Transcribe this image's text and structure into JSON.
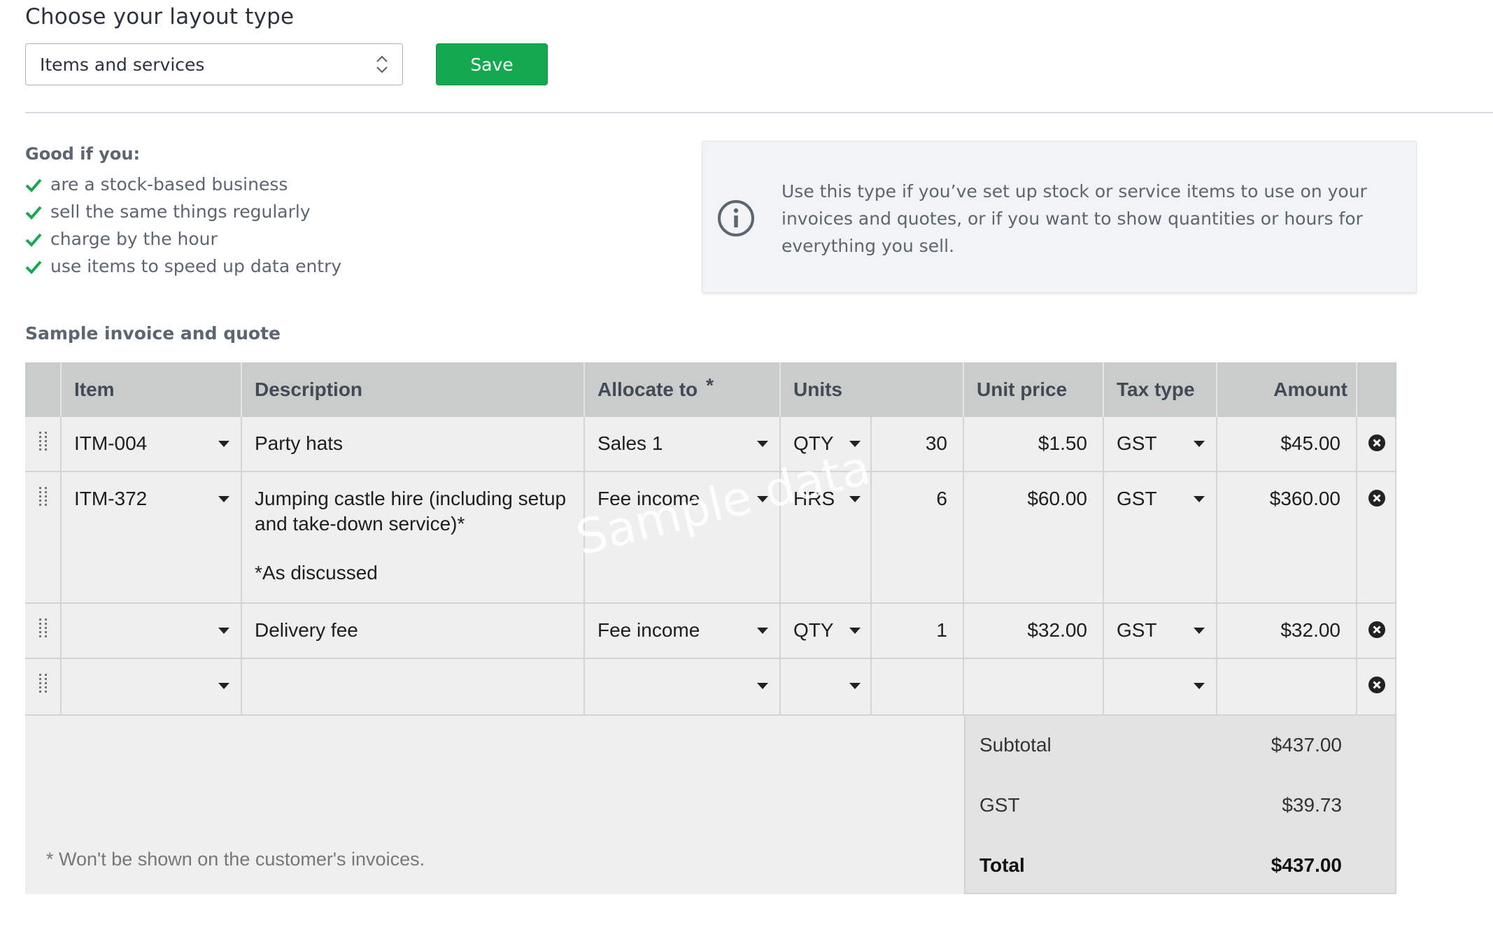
{
  "layout": {
    "title": "Choose your layout type",
    "selected": "Items and services",
    "save_label": "Save"
  },
  "good_if": {
    "heading": "Good if you:",
    "items": [
      "are a stock-based business",
      "sell the same things regularly",
      "charge by the hour",
      "use items to speed up data entry"
    ]
  },
  "info": {
    "text": "Use this type if you’ve set up stock or service items to use on your invoices and quotes, or if you want to show quantities or hours for everything you sell."
  },
  "sample": {
    "heading": "Sample invoice and quote",
    "watermark": "Sample data",
    "columns": {
      "item": "Item",
      "description": "Description",
      "allocate": "Allocate to",
      "allocate_mark": "*",
      "units": "Units",
      "unit_price": "Unit price",
      "tax_type": "Tax type",
      "amount": "Amount"
    },
    "rows": [
      {
        "item": "ITM-004",
        "description": [
          "Party hats"
        ],
        "allocate": "Sales 1",
        "unit": "QTY",
        "qty": "30",
        "unit_price": "$1.50",
        "tax": "GST",
        "amount": "$45.00"
      },
      {
        "item": "ITM-372",
        "description": [
          "Jumping castle hire (including setup",
          "and take-down service)*",
          "*As discussed"
        ],
        "allocate": "Fee income",
        "unit": "HRS",
        "qty": "6",
        "unit_price": "$60.00",
        "tax": "GST",
        "amount": "$360.00"
      },
      {
        "item": "",
        "description": [
          "Delivery fee"
        ],
        "allocate": "Fee income",
        "unit": "QTY",
        "qty": "1",
        "unit_price": "$32.00",
        "tax": "GST",
        "amount": "$32.00"
      },
      {
        "item": "",
        "description": [
          ""
        ],
        "allocate": "",
        "unit": "",
        "qty": "",
        "unit_price": "",
        "tax": "",
        "amount": ""
      }
    ],
    "totals": {
      "subtotal_label": "Subtotal",
      "subtotal": "$437.00",
      "tax_label": "GST",
      "tax": "$39.73",
      "total_label": "Total",
      "total": "$437.00"
    },
    "footnote": "* Won't be shown on the customer's invoices."
  }
}
